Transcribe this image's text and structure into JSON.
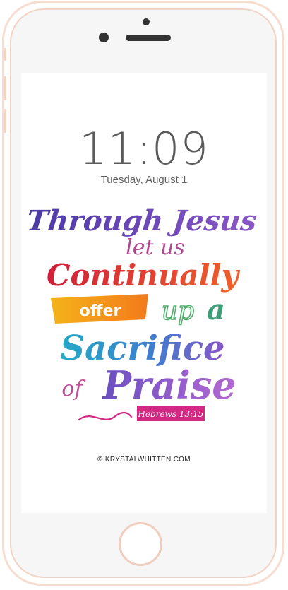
{
  "lockscreen": {
    "time": "11:09",
    "date": "Tuesday, August 1"
  },
  "wallpaper": {
    "lines": [
      "Through Jesus",
      "let us",
      "Continually",
      "offer",
      "up",
      "a",
      "Sacrifice",
      "of",
      "Praise"
    ],
    "reference": "Hebrews 13:15",
    "credit": "© KRYSTALWHITTEN.COM"
  },
  "colors": {
    "frame": "#f6ddd0",
    "indigo": "#4b3aa6",
    "violet": "#8a56c7",
    "red": "#e02634",
    "orange": "#f38b1c",
    "green": "#4fb06b",
    "teal": "#22a6c3",
    "magenta": "#d22a84"
  }
}
